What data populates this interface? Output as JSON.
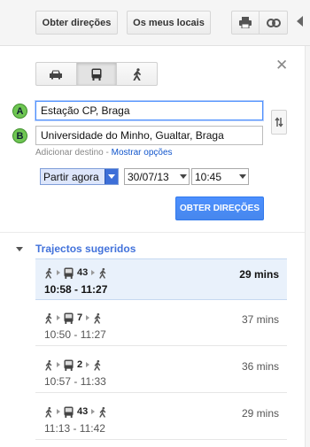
{
  "toolbar": {
    "directions_label": "Obter direções",
    "places_label": "Os meus locais",
    "print_icon": "print-icon",
    "link_icon": "link-icon"
  },
  "modes": [
    {
      "name": "car",
      "icon": "car-icon",
      "active": false
    },
    {
      "name": "transit",
      "icon": "bus-icon",
      "active": true
    },
    {
      "name": "walk",
      "icon": "walk-icon",
      "active": false
    }
  ],
  "waypoints": {
    "a": {
      "marker": "A",
      "value": "Estação CP, Braga"
    },
    "b": {
      "marker": "B",
      "value": "Universidade do Minho, Gualtar, Braga"
    },
    "add_destination": "Adicionar destino",
    "separator": "-",
    "show_options": "Mostrar opções"
  },
  "time": {
    "depart_mode": "Partir agora",
    "date": "30/07/13",
    "time": "10:45"
  },
  "get_directions_label": "OBTER DIREÇÕES",
  "suggested": {
    "title": "Trajectos sugeridos",
    "routes": [
      {
        "line": "43",
        "times": "10:58 - 11:27",
        "duration": "29 mins",
        "selected": true
      },
      {
        "line": "7",
        "times": "10:50 - 11:27",
        "duration": "37 mins",
        "selected": false
      },
      {
        "line": "2",
        "times": "10:57 - 11:33",
        "duration": "36 mins",
        "selected": false
      },
      {
        "line": "43",
        "times": "11:13 - 11:42",
        "duration": "29 mins",
        "selected": false
      }
    ]
  },
  "colors": {
    "accent_blue": "#4d90fe",
    "link_blue": "#1155cc",
    "marker_green": "#6fc653",
    "title_blue": "#4272db"
  }
}
